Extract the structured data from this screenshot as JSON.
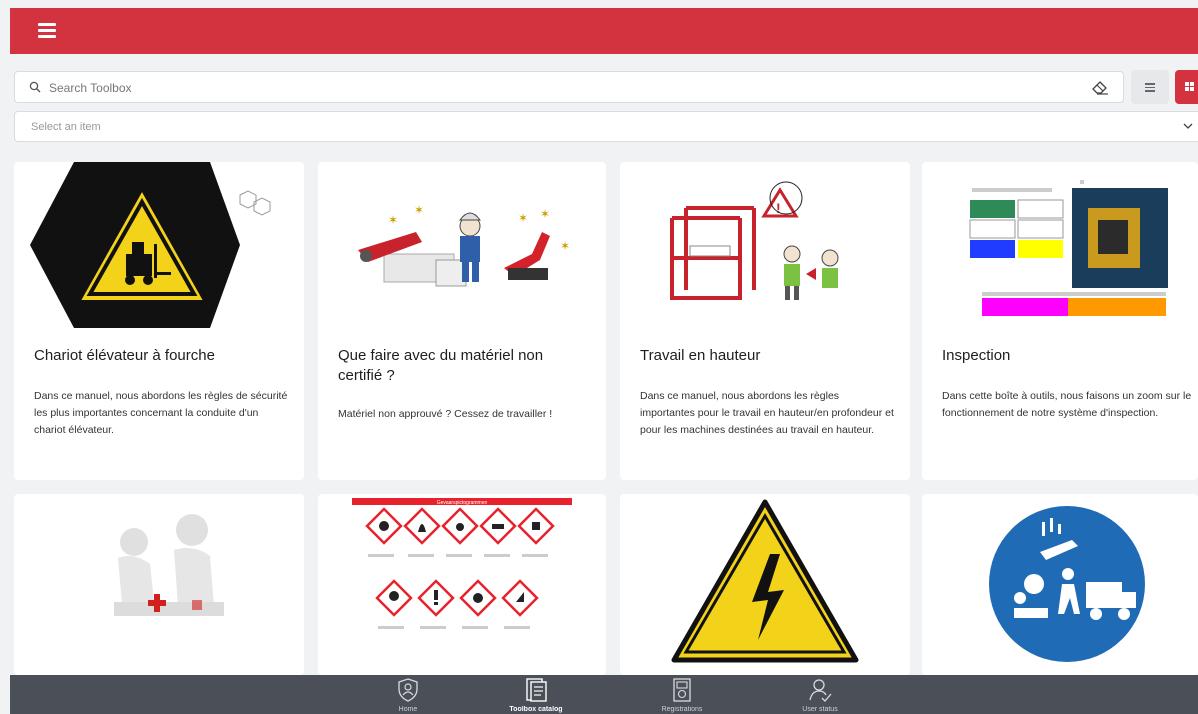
{
  "header": {
    "brand_color": "#d3323f",
    "menu_icon": "hamburger-menu-icon"
  },
  "search": {
    "placeholder": "Search Toolbox",
    "value": "",
    "clear_icon": "eraser-icon"
  },
  "view_toggle": {
    "list_icon": "list-view-icon",
    "grid_icon": "grid-view-icon",
    "active": "grid"
  },
  "filter": {
    "placeholder": "Select an item"
  },
  "cards": [
    {
      "title": "Chariot élévateur à fourche",
      "description": "Dans ce manuel, nous abordons les règles de sécurité les plus importantes concernant la conduite d'un chariot élévateur."
    },
    {
      "title": "Que faire avec du matériel non certifié ?",
      "description": "Matériel non approuvé ? Cessez de travailler !"
    },
    {
      "title": "Travail en hauteur",
      "description": "Dans ce manuel, nous abordons les règles importantes pour le travail en hauteur/en profondeur et pour les machines destinées au travail en hauteur."
    },
    {
      "title": "Inspection",
      "description": "Dans cette boîte à outils, nous faisons un zoom sur le fonctionnement de notre système d'inspection."
    }
  ],
  "row2_images": [
    {
      "icon": "first-aid-figures-icon"
    },
    {
      "icon": "hazard-pictograms-icon",
      "banner": "Gevaarspictogrammen"
    },
    {
      "icon": "electrical-hazard-icon"
    },
    {
      "icon": "maintenance-sign-icon"
    }
  ],
  "bottom_nav": [
    {
      "label": "Home",
      "icon": "shield-home-icon"
    },
    {
      "label": "Toolbox catalog",
      "icon": "toolbox-catalog-icon"
    },
    {
      "label": "Registrations",
      "icon": "registrations-icon"
    },
    {
      "label": "User status",
      "icon": "user-status-icon"
    }
  ]
}
